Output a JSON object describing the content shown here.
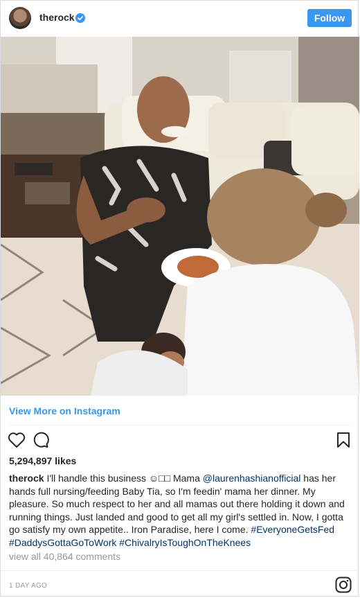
{
  "header": {
    "username": "therock",
    "follow_label": "Follow"
  },
  "post": {
    "view_more": "View More on Instagram",
    "likes": "5,294,897 likes",
    "caption": {
      "author": "therock",
      "text1": " I'll handle this business ☺︎□□ Mama ",
      "mention": "@laurenhashianofficial",
      "text2": " has her hands full nursing/feeding Baby Tia, so I'm feedin' mama her dinner. My pleasure. So much respect to her and all mamas out there holding it down and running things. Just landed and good to get all my girl's settled in. Now, I gotta go satisfy my own appetite.. Iron Paradise, here I come. ",
      "hashtag1": "#EveryoneGetsFed",
      "hashtag2": "#DaddysGottaGoToWork",
      "hashtag3": "#ChivalryIsToughOnTheKnees"
    },
    "comments_link": "view all 40,864 comments",
    "timestamp": "1 DAY AGO"
  },
  "icons": {
    "verified": "verified-badge-icon",
    "like": "heart-icon",
    "comment": "comment-icon",
    "save": "bookmark-icon",
    "instagram": "instagram-logo-icon"
  },
  "colors": {
    "accent": "#3897f0",
    "link": "#003569",
    "muted": "#999999"
  }
}
